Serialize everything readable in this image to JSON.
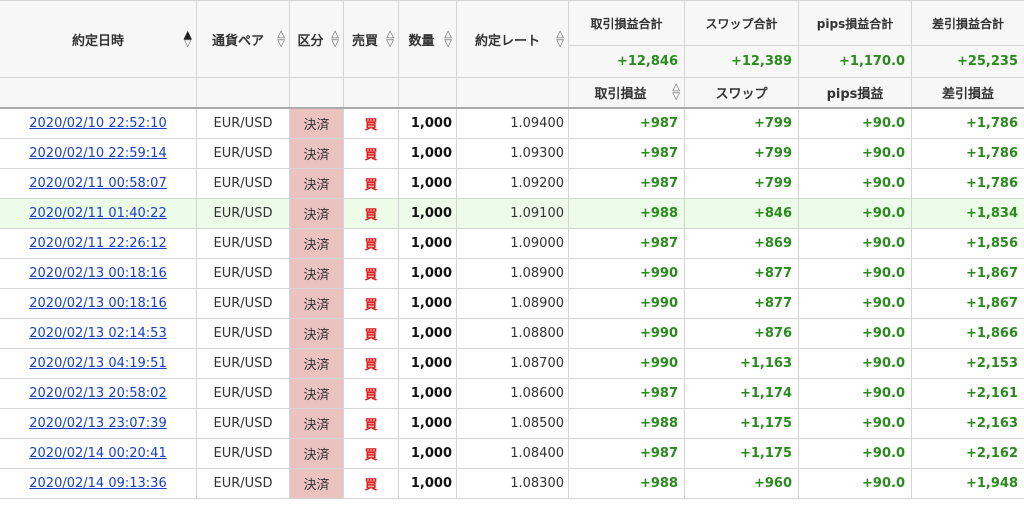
{
  "headers": {
    "datetime": "約定日時",
    "pair": "通貨ペア",
    "kubun": "区分",
    "side": "売買",
    "qty": "数量",
    "rate": "約定レート",
    "pl_total": "取引損益合計",
    "swap_total": "スワップ合計",
    "pips_total": "pips損益合計",
    "net_total": "差引損益合計",
    "pl": "取引損益",
    "swap": "スワップ",
    "pips": "pips損益",
    "net": "差引損益"
  },
  "totals": {
    "pl": "+12,846",
    "swap": "+12,389",
    "pips": "+1,170.0",
    "net": "+25,235"
  },
  "sort_icons": {
    "active_up": "▲",
    "up": "△",
    "down": "▽"
  },
  "rows": [
    {
      "datetime": "2020/02/10 22:52:10",
      "pair": "EUR/USD",
      "kubun": "決済",
      "side": "買",
      "qty": "1,000",
      "rate": "1.09400",
      "pl": "+987",
      "swap": "+799",
      "pips": "+90.0",
      "net": "+1,786"
    },
    {
      "datetime": "2020/02/10 22:59:14",
      "pair": "EUR/USD",
      "kubun": "決済",
      "side": "買",
      "qty": "1,000",
      "rate": "1.09300",
      "pl": "+987",
      "swap": "+799",
      "pips": "+90.0",
      "net": "+1,786"
    },
    {
      "datetime": "2020/02/11 00:58:07",
      "pair": "EUR/USD",
      "kubun": "決済",
      "side": "買",
      "qty": "1,000",
      "rate": "1.09200",
      "pl": "+987",
      "swap": "+799",
      "pips": "+90.0",
      "net": "+1,786"
    },
    {
      "datetime": "2020/02/11 01:40:22",
      "pair": "EUR/USD",
      "kubun": "決済",
      "side": "買",
      "qty": "1,000",
      "rate": "1.09100",
      "pl": "+988",
      "swap": "+846",
      "pips": "+90.0",
      "net": "+1,834"
    },
    {
      "datetime": "2020/02/11 22:26:12",
      "pair": "EUR/USD",
      "kubun": "決済",
      "side": "買",
      "qty": "1,000",
      "rate": "1.09000",
      "pl": "+987",
      "swap": "+869",
      "pips": "+90.0",
      "net": "+1,856"
    },
    {
      "datetime": "2020/02/13 00:18:16",
      "pair": "EUR/USD",
      "kubun": "決済",
      "side": "買",
      "qty": "1,000",
      "rate": "1.08900",
      "pl": "+990",
      "swap": "+877",
      "pips": "+90.0",
      "net": "+1,867"
    },
    {
      "datetime": "2020/02/13 00:18:16",
      "pair": "EUR/USD",
      "kubun": "決済",
      "side": "買",
      "qty": "1,000",
      "rate": "1.08900",
      "pl": "+990",
      "swap": "+877",
      "pips": "+90.0",
      "net": "+1,867"
    },
    {
      "datetime": "2020/02/13 02:14:53",
      "pair": "EUR/USD",
      "kubun": "決済",
      "side": "買",
      "qty": "1,000",
      "rate": "1.08800",
      "pl": "+990",
      "swap": "+876",
      "pips": "+90.0",
      "net": "+1,866"
    },
    {
      "datetime": "2020/02/13 04:19:51",
      "pair": "EUR/USD",
      "kubun": "決済",
      "side": "買",
      "qty": "1,000",
      "rate": "1.08700",
      "pl": "+990",
      "swap": "+1,163",
      "pips": "+90.0",
      "net": "+2,153"
    },
    {
      "datetime": "2020/02/13 20:58:02",
      "pair": "EUR/USD",
      "kubun": "決済",
      "side": "買",
      "qty": "1,000",
      "rate": "1.08600",
      "pl": "+987",
      "swap": "+1,174",
      "pips": "+90.0",
      "net": "+2,161"
    },
    {
      "datetime": "2020/02/13 23:07:39",
      "pair": "EUR/USD",
      "kubun": "決済",
      "side": "買",
      "qty": "1,000",
      "rate": "1.08500",
      "pl": "+988",
      "swap": "+1,175",
      "pips": "+90.0",
      "net": "+2,163"
    },
    {
      "datetime": "2020/02/14 00:20:41",
      "pair": "EUR/USD",
      "kubun": "決済",
      "side": "買",
      "qty": "1,000",
      "rate": "1.08400",
      "pl": "+987",
      "swap": "+1,175",
      "pips": "+90.0",
      "net": "+2,162"
    },
    {
      "datetime": "2020/02/14 09:13:36",
      "pair": "EUR/USD",
      "kubun": "決済",
      "side": "買",
      "qty": "1,000",
      "rate": "1.08300",
      "pl": "+988",
      "swap": "+960",
      "pips": "+90.0",
      "net": "+1,948"
    }
  ],
  "colors": {
    "positive": "#2a8a1d",
    "buy": "#d62020",
    "link": "#1a3fc4",
    "kubun_bg": "#eac3c1",
    "highlight_row": "#edfbe9",
    "header_bg": "#f7f7f7"
  }
}
